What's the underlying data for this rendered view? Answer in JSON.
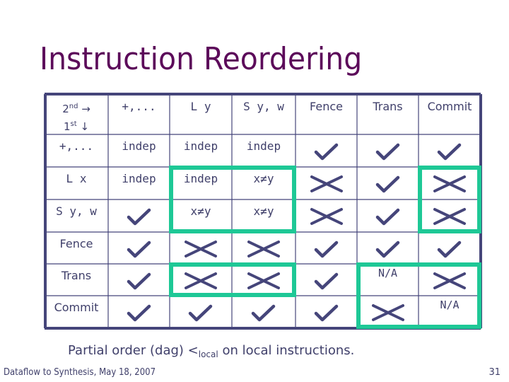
{
  "slide": {
    "title": "Instruction Reordering",
    "caption_prefix": "Partial order (dag) ",
    "caption_symbol": "<",
    "caption_subscript": "local",
    "caption_suffix": " on local instructions.",
    "footer": "Dataflow to Synthesis, May 18, 2007",
    "page_number": "31"
  },
  "colors": {
    "title": "#5c0a5a",
    "text": "#3f3f6a",
    "border": "#45457a",
    "highlight": "#1ec896"
  },
  "table": {
    "corner": {
      "top_num": "2",
      "top_sup": "nd",
      "top_arrow": "→",
      "bottom_num": "1",
      "bottom_sup": "st",
      "bottom_arrow": "↓"
    },
    "columns": [
      "+,...",
      "L y",
      "S y, w",
      "Fence",
      "Trans",
      "Commit"
    ],
    "rows": [
      {
        "label": "+,...",
        "cells": [
          {
            "t": "text",
            "v": "indep"
          },
          {
            "t": "text",
            "v": "indep"
          },
          {
            "t": "text",
            "v": "indep"
          },
          {
            "t": "check"
          },
          {
            "t": "check"
          },
          {
            "t": "check"
          }
        ]
      },
      {
        "label": "L x",
        "cells": [
          {
            "t": "text",
            "v": "indep"
          },
          {
            "t": "text",
            "v": "indep"
          },
          {
            "t": "text",
            "v": "x≠y"
          },
          {
            "t": "cross"
          },
          {
            "t": "check"
          },
          {
            "t": "cross"
          }
        ]
      },
      {
        "label": "S y, w",
        "cells": [
          {
            "t": "check"
          },
          {
            "t": "text",
            "v": "x≠y"
          },
          {
            "t": "text",
            "v": "x≠y"
          },
          {
            "t": "cross"
          },
          {
            "t": "check"
          },
          {
            "t": "cross"
          }
        ]
      },
      {
        "label": "Fence",
        "cells": [
          {
            "t": "check"
          },
          {
            "t": "cross"
          },
          {
            "t": "cross"
          },
          {
            "t": "check"
          },
          {
            "t": "check"
          },
          {
            "t": "check"
          }
        ]
      },
      {
        "label": "Trans",
        "cells": [
          {
            "t": "check"
          },
          {
            "t": "cross"
          },
          {
            "t": "cross"
          },
          {
            "t": "check"
          },
          {
            "t": "text",
            "v": "N/A"
          },
          {
            "t": "cross"
          }
        ]
      },
      {
        "label": "Commit",
        "cells": [
          {
            "t": "check"
          },
          {
            "t": "check"
          },
          {
            "t": "check"
          },
          {
            "t": "check"
          },
          {
            "t": "cross"
          },
          {
            "t": "text",
            "v": "N/A"
          }
        ]
      }
    ],
    "highlight_groups": [
      {
        "name": "load-store-aliasing",
        "rows": [
          2,
          3
        ],
        "cols": [
          2,
          3
        ]
      },
      {
        "name": "commit-column-loadstore",
        "rows": [
          2,
          3
        ],
        "cols": [
          6
        ]
      },
      {
        "name": "trans-vs-loadstore",
        "rows": [
          5
        ],
        "cols": [
          2,
          3
        ]
      },
      {
        "name": "trans-commit-block",
        "rows": [
          5,
          6
        ],
        "cols": [
          5,
          6
        ]
      }
    ]
  }
}
